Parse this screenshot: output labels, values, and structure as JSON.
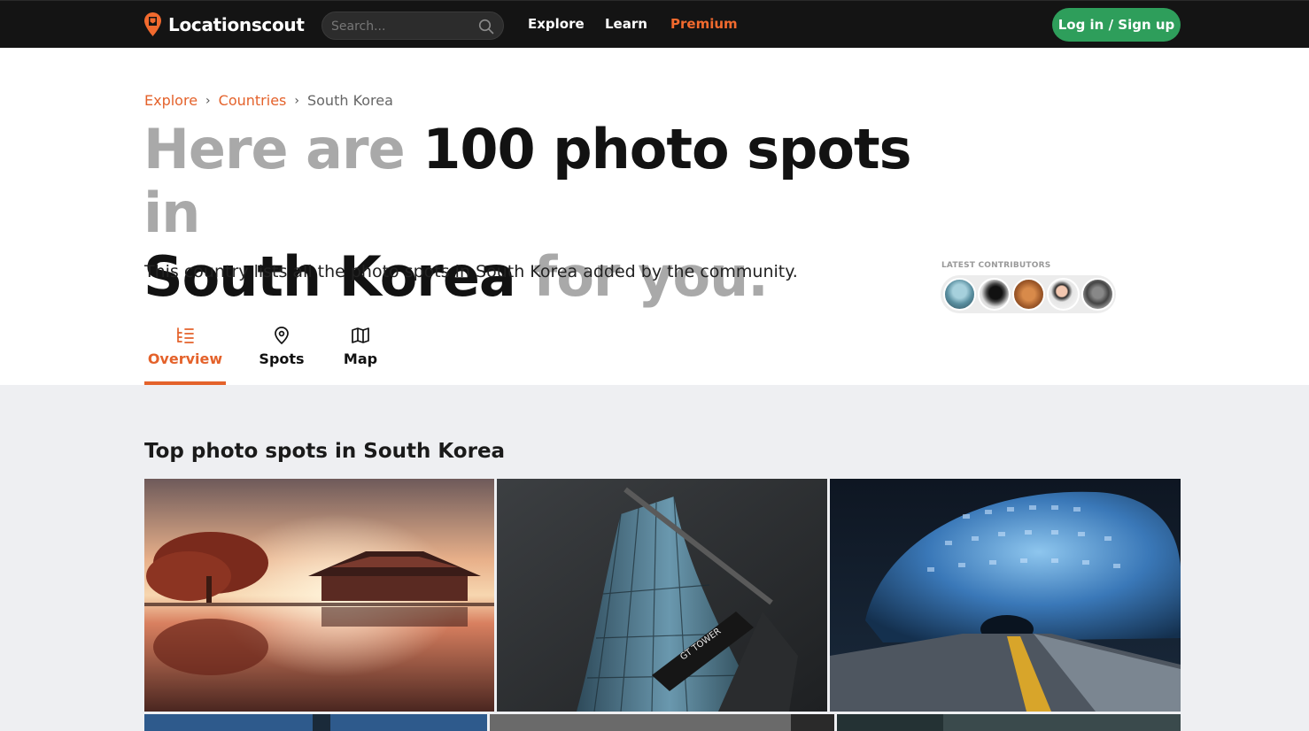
{
  "nav": {
    "brand": "Locationscout",
    "search_placeholder": "Search...",
    "links": [
      "Explore",
      "Learn",
      "Premium"
    ],
    "login_label": "Log in / Sign up"
  },
  "breadcrumb": {
    "items": [
      "Explore",
      "Countries"
    ],
    "current": "South Korea"
  },
  "hero": {
    "part1": "Here are ",
    "count": "100 photo spots",
    "part2": " in",
    "country": "South Korea",
    "part3": " for you."
  },
  "subtitle": "This country lists all the photo spots in South Korea added by the community.",
  "contributors": {
    "label": "LATEST CONTRIBUTORS"
  },
  "tabs": [
    {
      "label": "Overview",
      "icon": "list-tree-icon",
      "active": true
    },
    {
      "label": "Spots",
      "icon": "map-pin-icon",
      "active": false
    },
    {
      "label": "Map",
      "icon": "folded-map-icon",
      "active": false
    }
  ],
  "section": {
    "title": "Top photo spots in South Korea"
  },
  "colors": {
    "accent": "#e4622b",
    "login": "#2e9e5b",
    "nav_bg": "#141414"
  }
}
